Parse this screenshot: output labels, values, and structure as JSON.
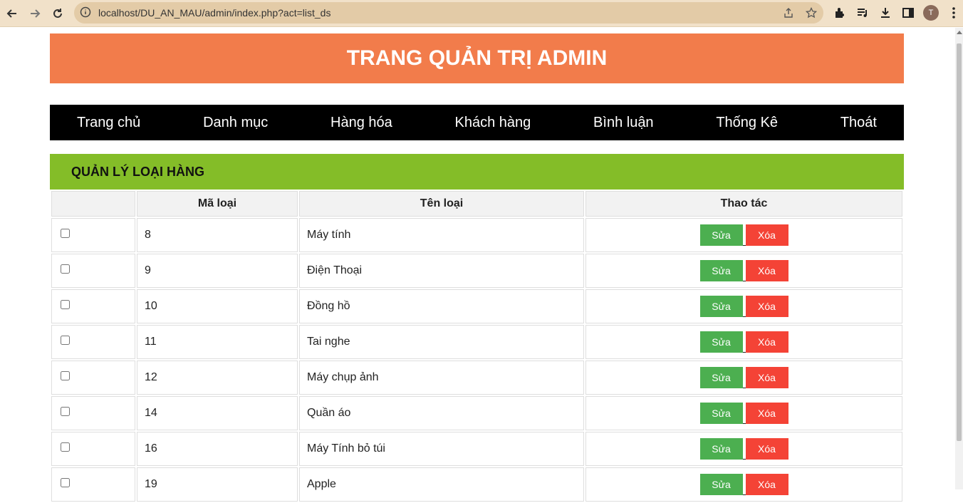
{
  "browser": {
    "url": "localhost/DU_AN_MAU/admin/index.php?act=list_ds",
    "avatar_letter": "T"
  },
  "page": {
    "header_title": "TRANG QUẢN TRỊ ADMIN",
    "menu": [
      "Trang chủ",
      "Danh mục",
      "Hàng hóa",
      "Khách hàng",
      "Bình luận",
      "Thống Kê",
      "Thoát"
    ],
    "section_title": "QUẢN LÝ LOẠI HÀNG"
  },
  "table": {
    "headers": [
      "",
      "Mã loại",
      "Tên loại",
      "Thao tác"
    ],
    "edit_label": "Sửa",
    "delete_label": "Xóa",
    "rows": [
      {
        "id": "8",
        "name": "Máy tính"
      },
      {
        "id": "9",
        "name": "Điện Thoại"
      },
      {
        "id": "10",
        "name": "Đồng hồ"
      },
      {
        "id": "11",
        "name": "Tai nghe"
      },
      {
        "id": "12",
        "name": "Máy chụp ảnh"
      },
      {
        "id": "14",
        "name": "Quần áo"
      },
      {
        "id": "16",
        "name": "Máy Tính bỏ túi"
      },
      {
        "id": "19",
        "name": "Apple"
      }
    ]
  },
  "colors": {
    "header_bg": "#f27c4b",
    "menu_bg": "#000000",
    "section_bg": "#84bd28",
    "edit_btn": "#4caf50",
    "delete_btn": "#f44336"
  }
}
